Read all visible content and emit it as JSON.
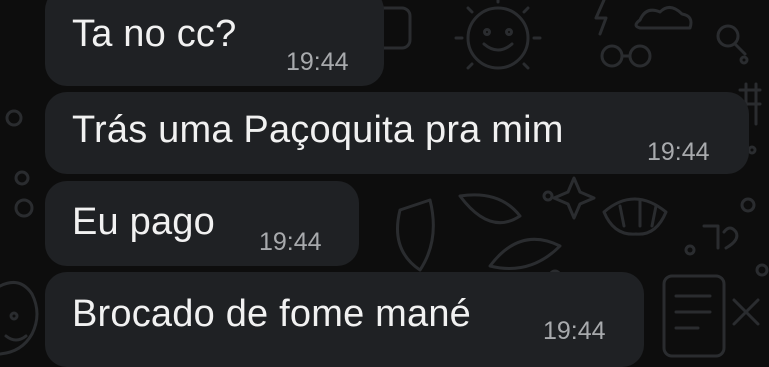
{
  "theme": {
    "background": "#0d0d0d",
    "bubble_color": "#1f2124",
    "message_text_color": "#f1f1f1",
    "timestamp_color": "#a8aaad",
    "wallpaper_doodle_color": "#2a2c2f"
  },
  "messages": [
    {
      "text": "Ta no cc?",
      "time": "19:44"
    },
    {
      "text": "Trás uma Paçoquita pra mim",
      "time": "19:44"
    },
    {
      "text": "Eu pago",
      "time": "19:44"
    },
    {
      "text": "Brocado de fome mané",
      "time": "19:44"
    }
  ]
}
